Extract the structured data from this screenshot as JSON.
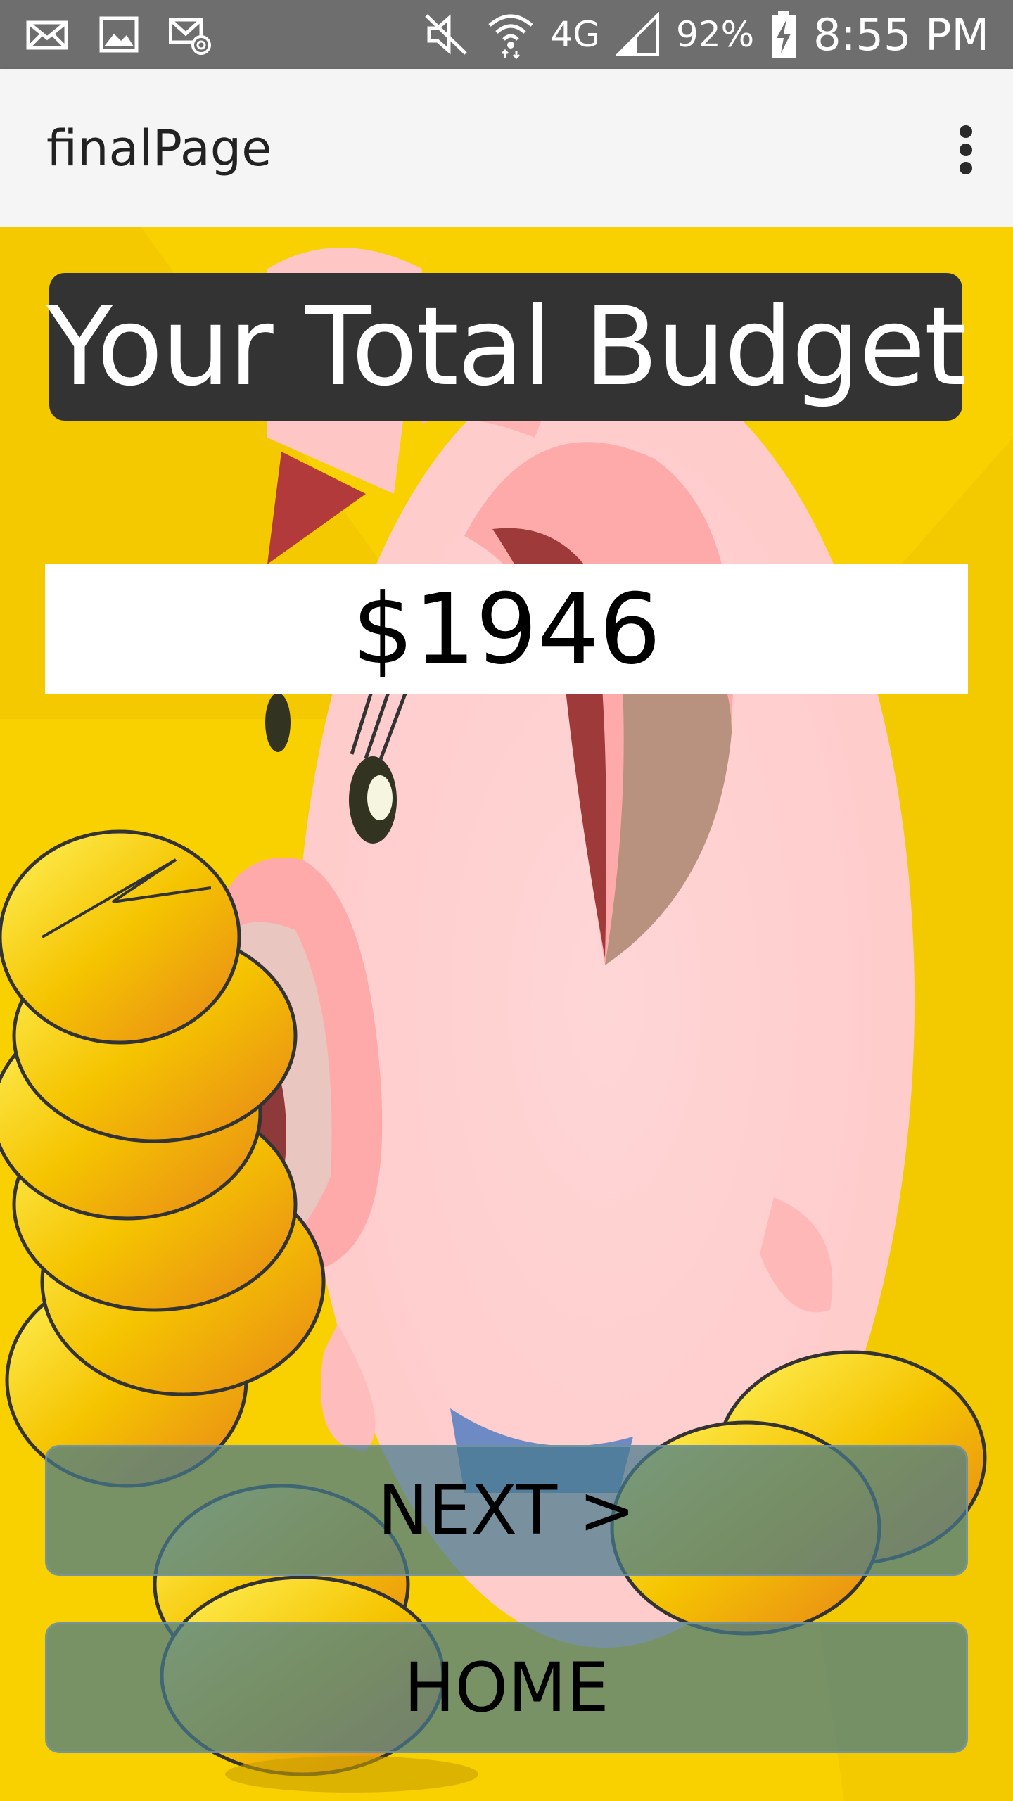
{
  "status_bar": {
    "battery": "92%",
    "time": "8:55 PM",
    "network": "4G",
    "icons": [
      "email-icon",
      "image-icon",
      "email-at-icon",
      "mute-icon",
      "wifi-icon",
      "network-4g-icon",
      "signal-icon",
      "battery-charging-icon"
    ]
  },
  "app_bar": {
    "title": "finalPage",
    "menu_icon": "more-vert-icon"
  },
  "main": {
    "heading": "Your Total Budget",
    "budget_value": "$1946",
    "next_label": "NEXT >",
    "home_label": "HOME",
    "background_image": "piggy-bank-with-coins"
  },
  "colors": {
    "background_yellow": "#f9d100",
    "heading_bg": "#333333",
    "button_bg": "#457a8c",
    "status_bar": "#6e6e6e",
    "app_bar": "#f5f5f5"
  }
}
